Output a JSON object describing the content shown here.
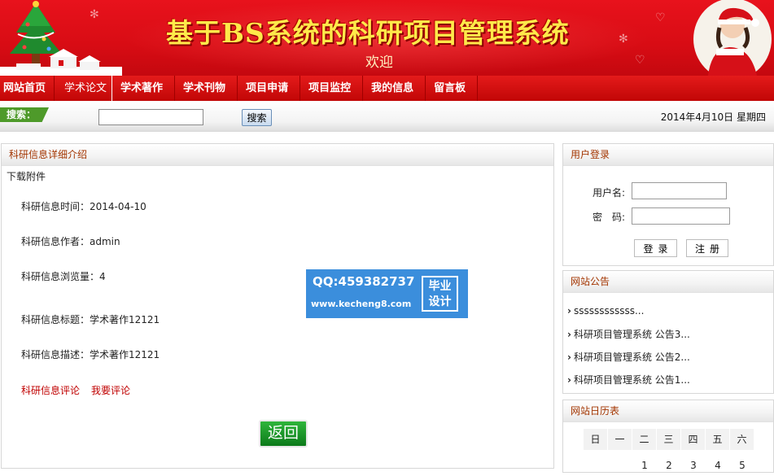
{
  "banner": {
    "title": "基于BS系统的科研项目管理系统",
    "subtitle": "欢迎"
  },
  "nav": {
    "items": [
      {
        "label": "网站首页"
      },
      {
        "label": "学术论文"
      },
      {
        "label": "学术著作"
      },
      {
        "label": "学术刊物"
      },
      {
        "label": "项目申请"
      },
      {
        "label": "项目监控"
      },
      {
        "label": "我的信息"
      },
      {
        "label": "留言板"
      }
    ]
  },
  "search": {
    "label": "搜索：",
    "value": "",
    "button": "搜索",
    "date": "2014年4月10日 星期四"
  },
  "detail": {
    "title": "科研信息详细介绍",
    "download": "下载附件",
    "time": "科研信息时间：2014-04-10",
    "author": "科研信息作者：admin",
    "views": "科研信息浏览量：4",
    "heading": "科研信息标题：学术著作12121",
    "description": "科研信息描述：学术著作12121",
    "comments_link": "科研信息评论",
    "add_comment_link": "我要评论",
    "back_button": "返回"
  },
  "watermark": {
    "qq": "QQ:459382737",
    "url": "www.kecheng8.com",
    "badge_line1": "毕业",
    "badge_line2": "设计"
  },
  "login": {
    "title": "用户登录",
    "username_label": "用户名:",
    "password_label": "密　码:",
    "username_value": "",
    "password_value": "",
    "login_button": "登录",
    "register_button": "注册"
  },
  "notice": {
    "title": "网站公告",
    "items": [
      "ssssssssssss...",
      "科研项目管理系统 公告3...",
      "科研项目管理系统 公告2...",
      "科研项目管理系统 公告1..."
    ]
  },
  "calendar": {
    "title": "网站日历表",
    "weekdays": [
      "日",
      "一",
      "二",
      "三",
      "四",
      "五",
      "六"
    ],
    "first_row": [
      "",
      "",
      "1",
      "2",
      "3",
      "4",
      "5"
    ]
  },
  "colors": {
    "banner_red": "#d80c14",
    "title_yellow": "#ffe94a",
    "panel_title": "#a33500",
    "link_red": "#c00000",
    "search_green": "#4e9a2a",
    "back_green": "#0c7a1a",
    "watermark_blue": "#3b8edc"
  }
}
